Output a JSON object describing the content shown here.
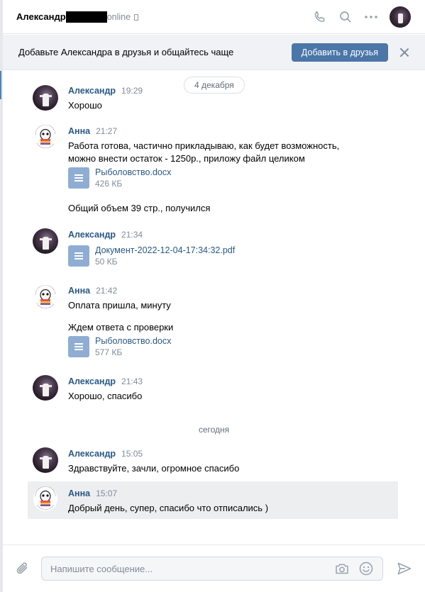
{
  "header": {
    "contact_name": "Александр",
    "status": "online",
    "icons": [
      "phone-icon",
      "search-icon",
      "more-icon"
    ]
  },
  "banner": {
    "text": "Добавьте Александра в друзья и общайтесь чаще",
    "button": "Добавить в друзья"
  },
  "history": {
    "date_1": "4 декабря",
    "date_2": "сегодня",
    "messages": [
      {
        "author": "Александр",
        "time": "19:29",
        "lines": [
          "Хорошо"
        ]
      },
      {
        "author": "Анна",
        "time": "21:27",
        "lines": [
          "Работа готова, частично прикладываю, как будет возможность,",
          "можно внести остаток - 1250р., приложу файл целиком"
        ],
        "file": {
          "name": "Рыболовство.docx",
          "size": "426 КБ"
        },
        "after": "Общий объем 39 стр., получился"
      },
      {
        "author": "Александр",
        "time": "21:34",
        "file": {
          "name": "Документ-2022-12-04-17:34:32.pdf",
          "size": "50 КБ"
        }
      },
      {
        "author": "Анна",
        "time": "21:42",
        "lines": [
          "Оплата пришла, минуту"
        ],
        "after": "Ждем ответа с проверки",
        "file": {
          "name": "Рыболовство.docx",
          "size": "577 КБ"
        }
      },
      {
        "author": "Александр",
        "time": "21:43",
        "lines": [
          "Хорошо, спасибо"
        ]
      },
      {
        "author": "Александр",
        "time": "15:05",
        "lines": [
          "Здравствуйте, зачли, огромное спасибо"
        ]
      },
      {
        "author": "Анна",
        "time": "15:07",
        "lines": [
          "Добрый день, супер, спасибо что отписались )"
        ]
      }
    ]
  },
  "composer": {
    "placeholder": "Напишите сообщение...",
    "value": ""
  },
  "colors": {
    "accent": "#4a76a8",
    "link": "#2a5885",
    "muted": "#818c99"
  }
}
